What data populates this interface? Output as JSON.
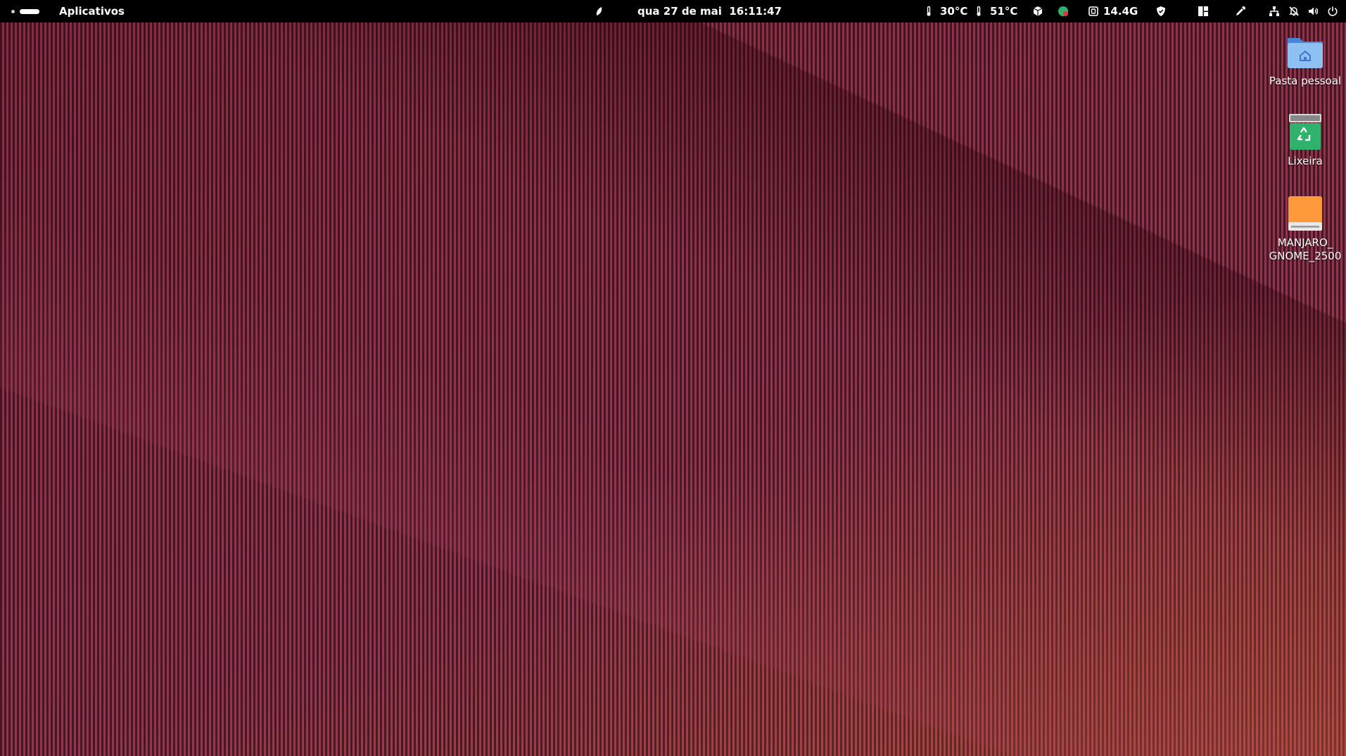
{
  "topbar": {
    "apps_label": "Aplicativos",
    "clock": "qua 27 de mai  16:11:47",
    "temp1": "30°C",
    "temp2": "51°C",
    "memory": "14.4G"
  },
  "desktop": {
    "icons": [
      {
        "label": "Pasta pessoal"
      },
      {
        "label": "Lixeira"
      },
      {
        "label": "MANJARO_\nGNOME_2500"
      }
    ]
  },
  "colors": {
    "topbar_bg": "#000000",
    "folder_blue": "#6fa8e8",
    "trash_green": "#2fb36c",
    "drive_orange": "#ff9a3c"
  }
}
